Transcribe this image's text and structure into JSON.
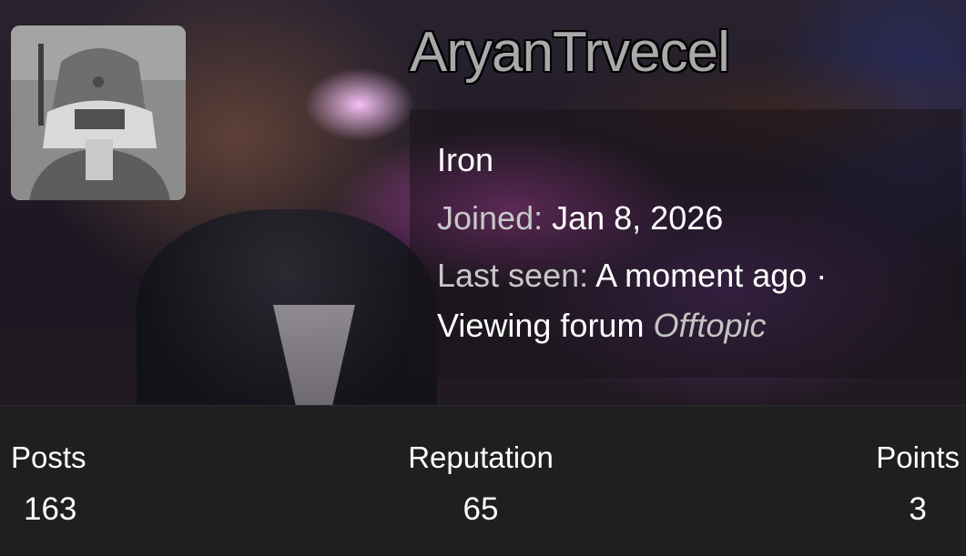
{
  "profile": {
    "username": "AryanTrvecel",
    "rank": "Iron",
    "joined_label": "Joined:",
    "joined_value": "Jan 8, 2026",
    "last_seen_label": "Last seen:",
    "last_seen_value": "A moment ago ·",
    "activity_text": "Viewing forum",
    "activity_target": "Offtopic",
    "avatar_icon": "avatar-photo"
  },
  "stats": {
    "posts_label": "Posts",
    "posts_value": "163",
    "reputation_label": "Reputation",
    "reputation_value": "65",
    "points_label": "Points",
    "points_value": "3"
  },
  "colors": {
    "username_fill": "#a9a9a9",
    "stats_bg": "#1f1f1f",
    "accent_glow": "#e060d8"
  }
}
